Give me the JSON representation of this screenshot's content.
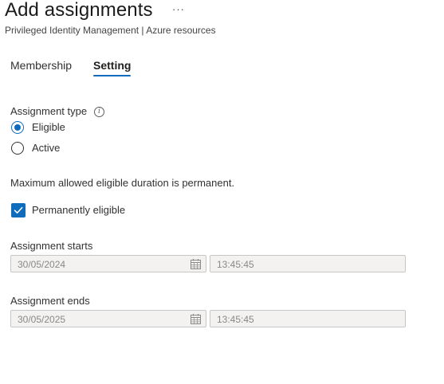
{
  "header": {
    "title": "Add assignments",
    "more": "···",
    "subtitle": "Privileged Identity Management | Azure resources"
  },
  "tabs": [
    {
      "label": "Membership",
      "selected": false
    },
    {
      "label": "Setting",
      "selected": true
    }
  ],
  "assignment_type": {
    "label": "Assignment type",
    "info_icon": "info-icon",
    "options": [
      {
        "label": "Eligible",
        "checked": true
      },
      {
        "label": "Active",
        "checked": false
      }
    ]
  },
  "duration_note": "Maximum allowed eligible duration is permanent.",
  "permanent": {
    "label": "Permanently eligible",
    "checked": true
  },
  "starts": {
    "label": "Assignment starts",
    "date": "30/05/2024",
    "time": "13:45:45"
  },
  "ends": {
    "label": "Assignment ends",
    "date": "30/05/2025",
    "time": "13:45:45"
  },
  "colors": {
    "accent": "#0f6cbd",
    "disabled_field": "#f3f2f1"
  }
}
